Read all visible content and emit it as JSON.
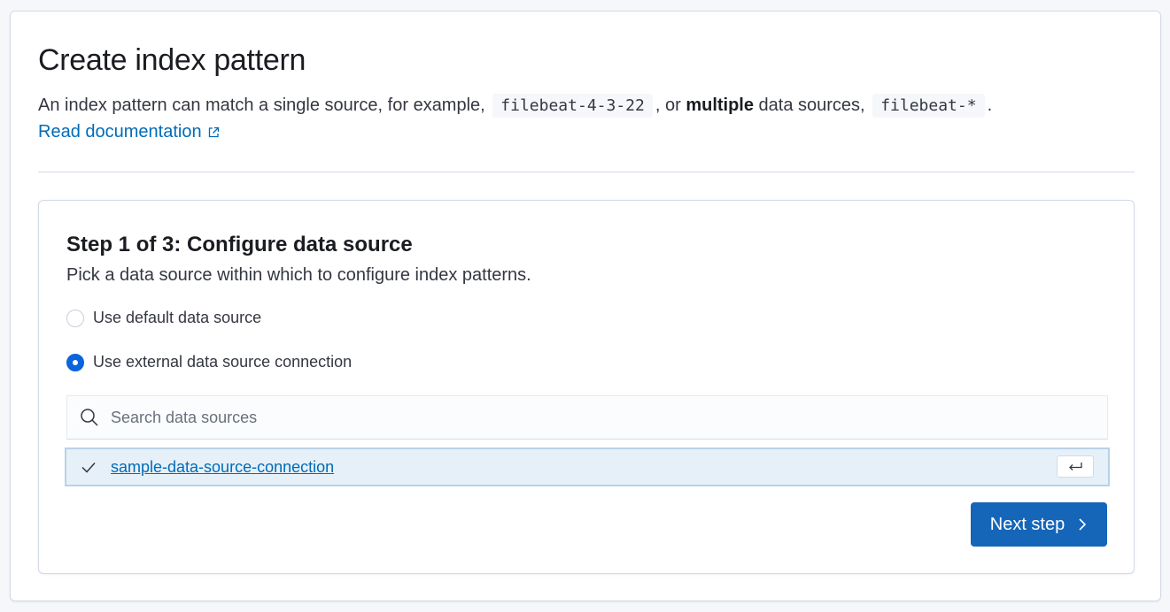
{
  "header": {
    "title": "Create index pattern",
    "intro_prefix": "An index pattern can match a single source, for example,",
    "example_single": "filebeat-4-3-22",
    "intro_mid": ", or",
    "intro_bold": "multiple",
    "intro_mid2": "data sources,",
    "example_multiple": "filebeat-*",
    "intro_suffix": ".",
    "doc_link": "Read documentation"
  },
  "step": {
    "title": "Step 1 of 3: Configure data source",
    "description": "Pick a data source within which to configure index patterns.",
    "options": [
      {
        "label": "Use default data source",
        "selected": false
      },
      {
        "label": "Use external data source connection",
        "selected": true
      }
    ],
    "search": {
      "placeholder": "Search data sources",
      "value": ""
    },
    "data_sources": [
      {
        "label": "sample-data-source-connection",
        "checked": true
      }
    ],
    "next_button": "Next step"
  },
  "colors": {
    "primary": "#1565b8",
    "link": "#006bb8",
    "selected_row": "#e6f0f8"
  }
}
